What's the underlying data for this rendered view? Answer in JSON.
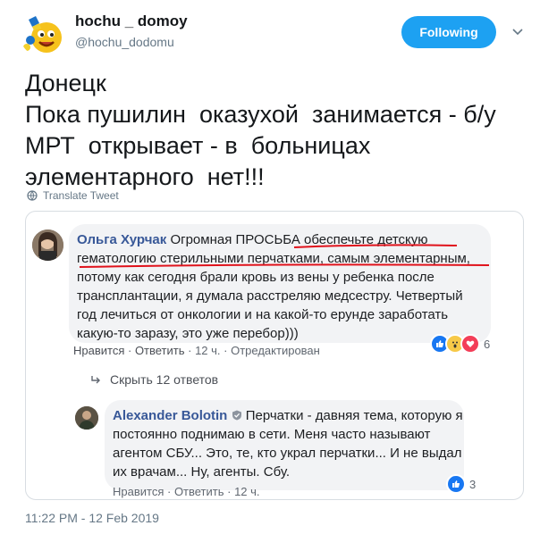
{
  "header": {
    "display_name": "hochu _ domoy",
    "handle": "@hochu_dodomu",
    "follow_label": "Following",
    "avatar_icon": "emoji-face-avatar",
    "menu_icon": "chevron-down-icon"
  },
  "tweet": {
    "lines": [
      "Донецк",
      "Пока пушилин  оказухой  занимается - б/у",
      "МРТ  открывает - в  больницах",
      "элементарного  нет!!!"
    ],
    "translate_label": "Translate Tweet",
    "timestamp": "11:22 PM - 12 Feb 2019"
  },
  "media": {
    "comment1": {
      "author": "Ольга Хурчак",
      "lines": [
        " Огромная ПРОСЬБА обеспечьте детскую",
        "гематологию стерильными перчатками, самым элементарным,",
        "потому как сегодня брали кровь из вены у ребенка после",
        "трансплантации, я думала расстреляю медсестру. Четвертый",
        "год лечиться от онкологии и на какой-то ерунде заработать",
        "какую-то заразу, это уже перебор)))"
      ],
      "like_label": "Нравится",
      "reply_label": "Ответить",
      "time": "12 ч.",
      "edited": "Отредактирован",
      "reaction_count": "6"
    },
    "hide_replies_label": "Скрыть 12 ответов",
    "comment2": {
      "author": "Alexander Bolotin",
      "lines": [
        "Перчатки - давняя тема, которую я",
        "постоянно поднимаю в сети. Меня часто называют",
        "агентом СБУ... Это, те, кто украл перчатки... И не выдал",
        "их врачам... Ну, агенты. Сбу."
      ],
      "like_label": "Нравится",
      "reply_label": "Ответить",
      "time": "12 ч.",
      "reaction_count": "3"
    }
  },
  "colors": {
    "accent": "#1da1f2",
    "fb_link": "#385898",
    "underline": "#e0121b"
  }
}
